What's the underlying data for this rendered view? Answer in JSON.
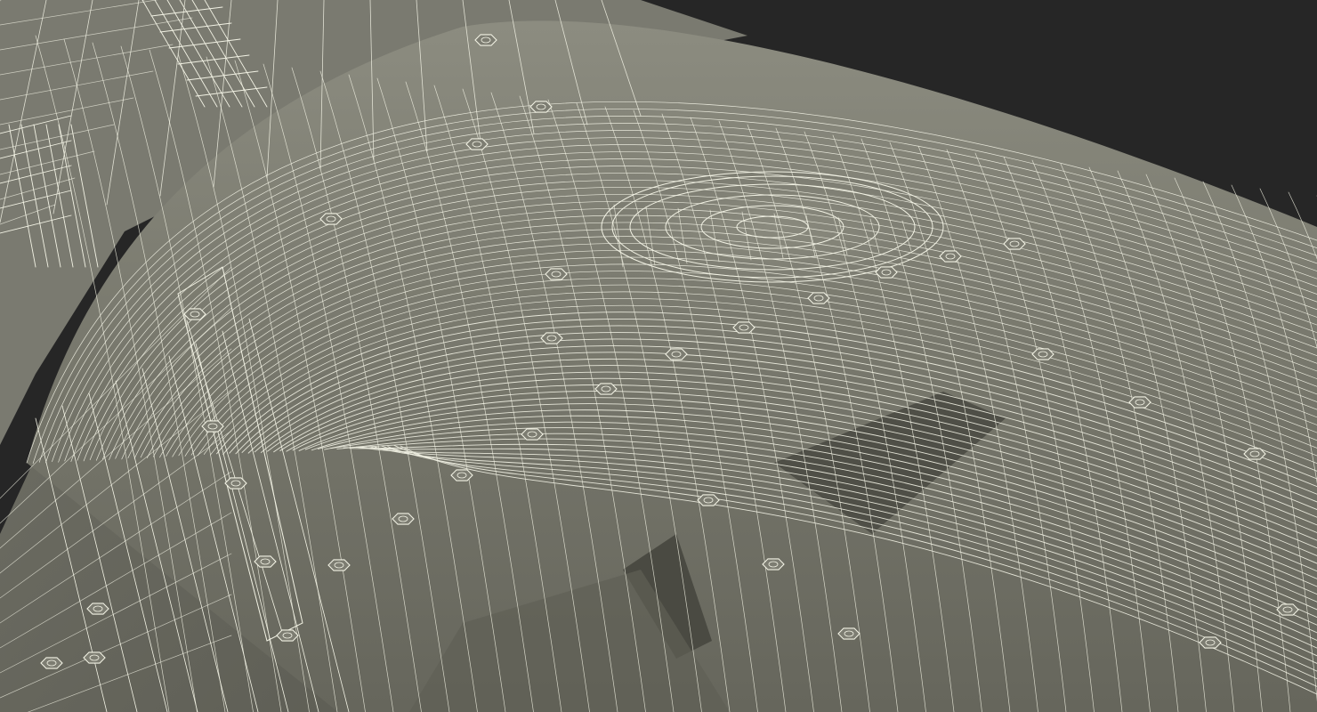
{
  "render": {
    "subject": "wireframe-3d-model",
    "colors": {
      "background": "#262626",
      "surface_light": "#8c8c80",
      "surface_mid": "#75756a",
      "surface_dark": "#5a5a50",
      "surface_shadow": "#45453e",
      "wire": "#f2f2e4"
    }
  }
}
